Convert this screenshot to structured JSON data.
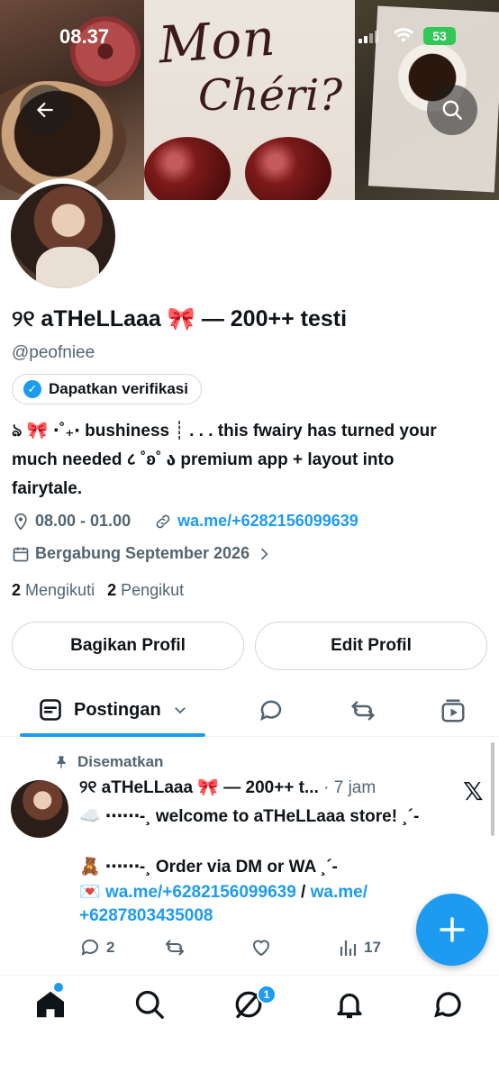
{
  "status_bar": {
    "time": "08.37",
    "battery": "53"
  },
  "profile": {
    "name": "୨୧ aTHeLLaaa 🎀 — 200++ testi",
    "handle": "@peofniee",
    "verify_label": "Dapatkan verifikasi",
    "bio_line1": "ঌ 🎀 ⋅˚₊‧ bushiness ┊ . . . this fwairy has turned your",
    "bio_line2": "much needed ८ ˚ʚ˚ ა premium app + layout into",
    "bio_line3": "fairytale.",
    "hours": "08.00 - 01.00",
    "link": "wa.me/+6282156099639",
    "joined": "Bergabung September 2026",
    "following_count": "2",
    "following_label": "Mengikuti",
    "followers_count": "2",
    "followers_label": "Pengikut"
  },
  "buttons": {
    "share": "Bagikan Profil",
    "edit": "Edit Profil"
  },
  "tabs": {
    "posts": "Postingan"
  },
  "post": {
    "pinned_label": "Disematkan",
    "author": "୨୧ aTHeLLaaa 🎀 — 200++ t...",
    "time": " · 7 jam",
    "line1": "☁️ ⋯⋯-¸ welcome to aTHeLLaaa store! ¸´-",
    "line2": "🧸 ⋯⋯-¸ Order via DM or WA ¸´-",
    "line3_prefix": "💌 ",
    "link1": "wa.me/+6282156099639",
    "separator": " / ",
    "link2_part1": "wa.me/",
    "link2_part2": "+6287803435008",
    "replies": "2",
    "views": "17"
  },
  "nav": {
    "notification_badge": "1"
  },
  "colors": {
    "accent": "#1d9bf0",
    "text": "#0f1419",
    "muted": "#536471",
    "border": "#cfd9de",
    "battery": "#33c759"
  },
  "icons": [
    "back-arrow-icon",
    "search-icon",
    "verified-badge-icon",
    "location-icon",
    "link-icon",
    "calendar-icon",
    "chevron-right-icon",
    "chevron-down-icon",
    "posts-icon",
    "replies-icon",
    "reposts-icon",
    "media-icon",
    "pin-icon",
    "x-logo-icon",
    "reply-icon",
    "repost-icon",
    "like-icon",
    "views-icon",
    "plus-icon",
    "home-icon",
    "explore-icon",
    "grok-icon",
    "notifications-icon",
    "messages-icon"
  ]
}
